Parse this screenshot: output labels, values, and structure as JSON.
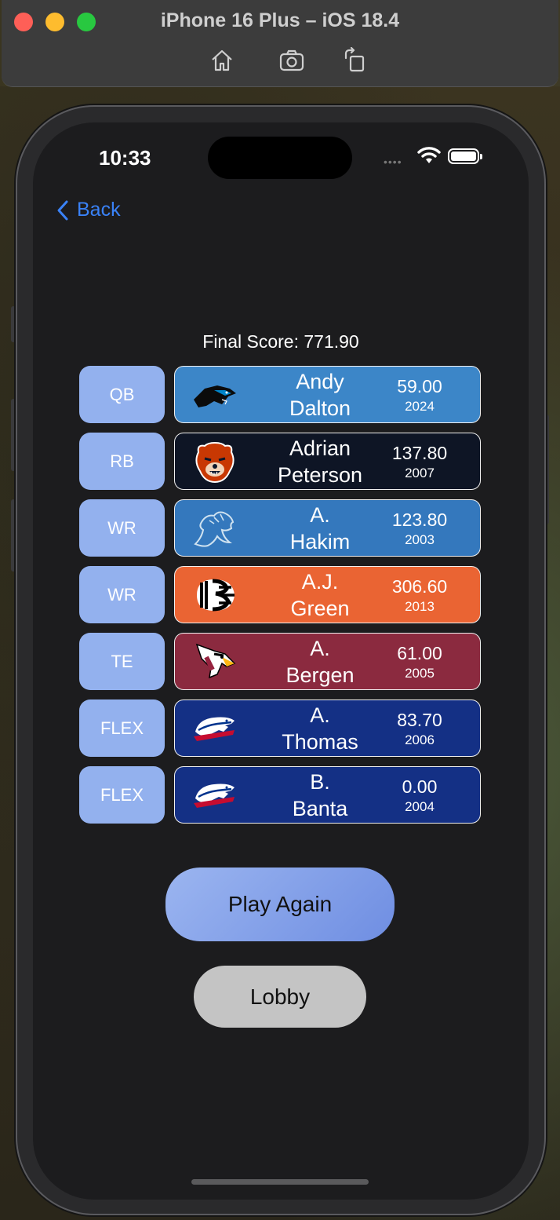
{
  "window": {
    "title": "iPhone 16 Plus – iOS 18.4",
    "toolbar_icons": [
      "home-icon",
      "screenshot-icon",
      "rotate-icon"
    ]
  },
  "status_bar": {
    "time": "10:33"
  },
  "nav": {
    "back_label": "Back"
  },
  "final_score_label": "Final Score: 771.90",
  "lineup": [
    {
      "position": "QB",
      "first": "Andy",
      "last": "Dalton",
      "points": "59.00",
      "year": "2024",
      "team": "panthers",
      "color": "#3c86c8"
    },
    {
      "position": "RB",
      "first": "Adrian",
      "last": "Peterson",
      "points": "137.80",
      "year": "2007",
      "team": "bears",
      "color": "#0e1525"
    },
    {
      "position": "WR",
      "first": "A.",
      "last": "Hakim",
      "points": "123.80",
      "year": "2003",
      "team": "lions",
      "color": "#3478bd"
    },
    {
      "position": "WR",
      "first": "A.J.",
      "last": "Green",
      "points": "306.60",
      "year": "2013",
      "team": "bengals",
      "color": "#ea6433"
    },
    {
      "position": "TE",
      "first": "A.",
      "last": "Bergen",
      "points": "61.00",
      "year": "2005",
      "team": "cardinals",
      "color": "#8b2a3f"
    },
    {
      "position": "FLEX",
      "first": "A.",
      "last": "Thomas",
      "points": "83.70",
      "year": "2006",
      "team": "bills",
      "color": "#143085"
    },
    {
      "position": "FLEX",
      "first": "B.",
      "last": "Banta",
      "points": "0.00",
      "year": "2004",
      "team": "bills",
      "color": "#143085"
    }
  ],
  "buttons": {
    "play_again": "Play Again",
    "lobby": "Lobby"
  }
}
